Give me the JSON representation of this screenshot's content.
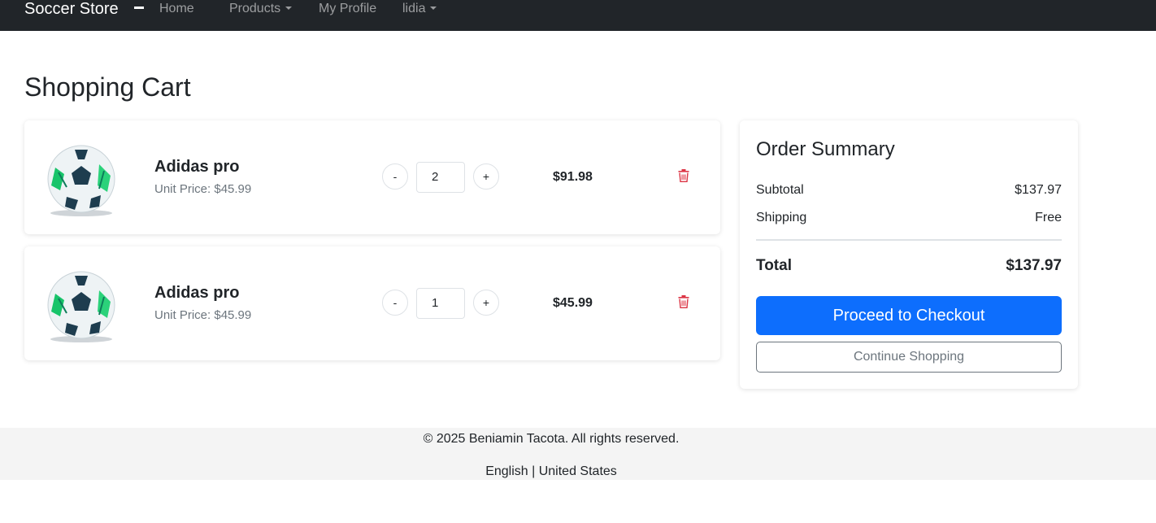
{
  "navbar": {
    "brand": "Soccer Store",
    "items": [
      {
        "label": "Home"
      },
      {
        "label": "Products"
      },
      {
        "label": "My Profile"
      },
      {
        "label": "lidia"
      }
    ]
  },
  "page": {
    "title": "Shopping Cart"
  },
  "cart": {
    "items": [
      {
        "name": "Adidas pro",
        "unit_price": "Unit Price: $45.99",
        "quantity": "2",
        "line_total": "$91.98",
        "minus": "-",
        "plus": "+"
      },
      {
        "name": "Adidas pro",
        "unit_price": "Unit Price: $45.99",
        "quantity": "1",
        "line_total": "$45.99",
        "minus": "-",
        "plus": "+"
      }
    ]
  },
  "summary": {
    "title": "Order Summary",
    "subtotal_label": "Subtotal",
    "subtotal_value": "$137.97",
    "shipping_label": "Shipping",
    "shipping_value": "Free",
    "total_label": "Total",
    "total_value": "$137.97",
    "checkout_label": "Proceed to Checkout",
    "continue_label": "Continue Shopping"
  },
  "footer": {
    "copyright": "© 2025 Beniamin Tacota. All rights reserved.",
    "locale": "English | United States"
  },
  "colors": {
    "navbar_bg": "#212529",
    "primary": "#0d6efd",
    "danger": "#dc3545",
    "footer_bg": "#f4f4f4"
  },
  "icons": {
    "delete": "trash-icon",
    "product_image": "soccer-ball-image"
  }
}
